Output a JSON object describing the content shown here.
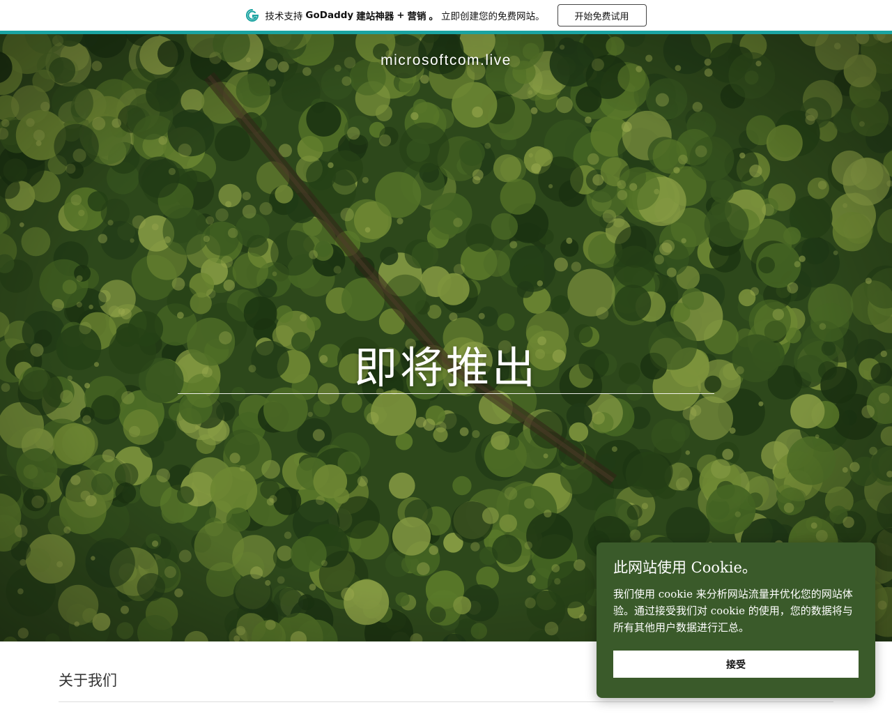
{
  "promo": {
    "prefix": "技术支持",
    "brand": "GoDaddy",
    "product": "建站神器",
    "plus": "+",
    "marketing": "营销",
    "dot": "。",
    "tagline": "立即创建您的免费网站。",
    "cta": "开始免费试用",
    "accent_color": "#1ba3a1",
    "icon": "godaddy-logo-icon"
  },
  "hero": {
    "site_name": "microsoftcom.live",
    "title": "即将推出"
  },
  "about": {
    "heading": "关于我们"
  },
  "cookie": {
    "title": "此网站使用 Cookie。",
    "body": "我们使用 cookie 来分析网站流量并优化您的网站体验。通过接受我们对 cookie 的使用，您的数据将与所有其他用户数据进行汇总。",
    "accept": "接受",
    "bg_color": "#3a5a2a"
  }
}
